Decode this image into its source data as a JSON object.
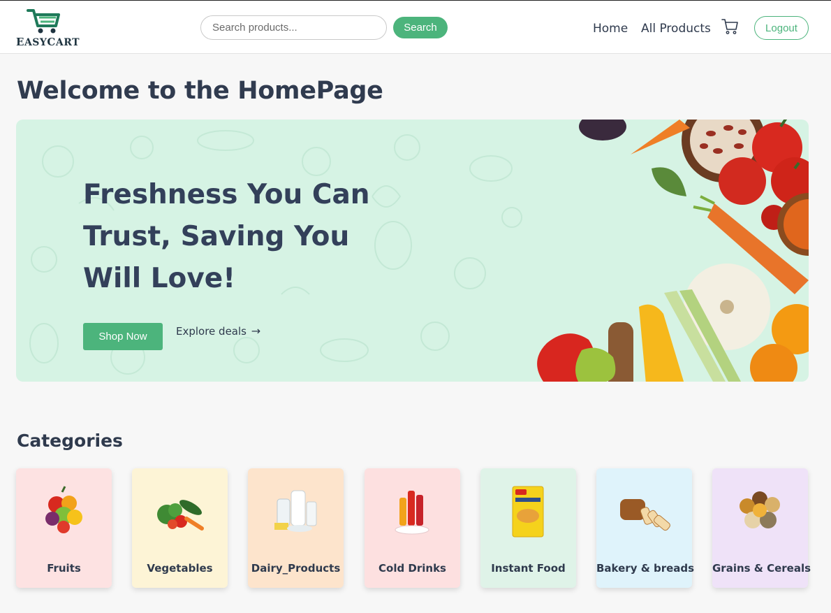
{
  "header": {
    "logo_text": "EasyCart",
    "logo_initial_1": "E",
    "logo_rest_1": "ASY",
    "logo_initial_2": "C",
    "logo_rest_2": "ART",
    "search_placeholder": "Search products...",
    "search_button": "Search",
    "nav": {
      "home": "Home",
      "all_products": "All Products"
    },
    "cart_icon": "cart-icon",
    "logout": "Logout"
  },
  "page_title": "Welcome to the HomePage",
  "hero": {
    "title": "Freshness You Can Trust, Saving You Will Love!",
    "shop_now": "Shop Now",
    "explore_deals": "Explore deals",
    "explore_icon": "arrow-right-icon"
  },
  "categories": {
    "heading": "Categories",
    "items": [
      {
        "label": "Fruits",
        "bg": "#fde2e2"
      },
      {
        "label": "Vegetables",
        "bg": "#fdf4d6"
      },
      {
        "label": "Dairy_Products",
        "bg": "#fde4cc"
      },
      {
        "label": "Cold Drinks",
        "bg": "#fde0e0"
      },
      {
        "label": "Instant Food",
        "bg": "#dff3e8"
      },
      {
        "label": "Bakery & breads",
        "bg": "#dff3fb"
      },
      {
        "label": "Grains & Cereals",
        "bg": "#efe2f8"
      }
    ]
  },
  "colors": {
    "accent": "#4cb47c",
    "text": "#2f3a4d",
    "hero_bg": "#d6f3e4",
    "page_bg": "#f7f7f7"
  }
}
